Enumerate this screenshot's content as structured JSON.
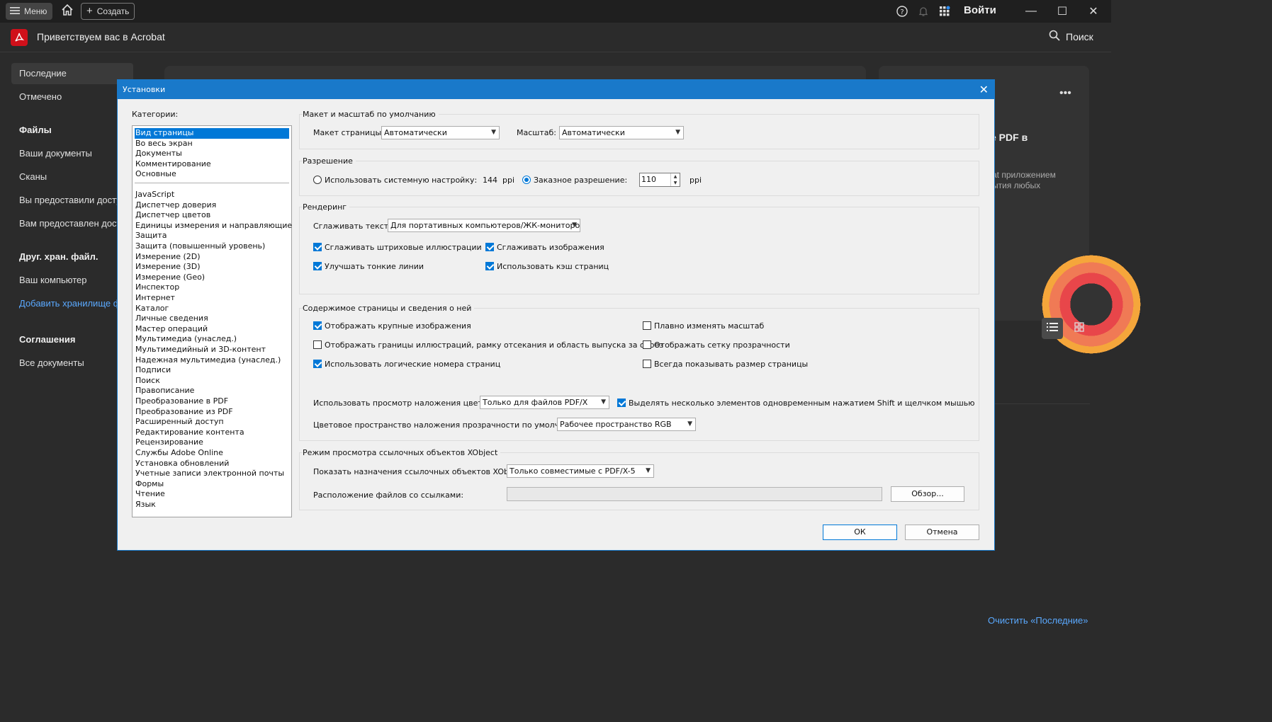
{
  "topbar": {
    "menu_label": "Меню",
    "create_label": "Создать",
    "signin_label": "Войти"
  },
  "app": {
    "title": "Приветствуем вас в Acrobat",
    "search_label": "Поиск"
  },
  "sidebar": {
    "recent": "Последние",
    "starred": "Отмечено",
    "files_heading": "Файлы",
    "your_docs": "Ваши документы",
    "scans": "Сканы",
    "shared_by_you": "Вы предоставили досту",
    "shared_with_you": "Вам предоставлен дост",
    "other_storage_heading": "Друг. хран. файл.",
    "your_computer": "Ваш компьютер",
    "add_storage": "Добавить хранилище ф",
    "agreements_heading": "Соглашения",
    "all_docs": "Все документы"
  },
  "background": {
    "pdf_title": "e PDF в",
    "pdf_desc": "at приложением\nытия любых",
    "clear_recent": "Очистить «Последние»"
  },
  "dialog": {
    "title": "Установки",
    "categories_label": "Категории:",
    "categories_top": [
      "Вид страницы",
      "Во весь экран",
      "Документы",
      "Комментирование",
      "Основные"
    ],
    "categories": [
      "JavaScript",
      "Диспетчер доверия",
      "Диспетчер цветов",
      "Единицы измерения и направляющие",
      "Защита",
      "Защита (повышенный уровень)",
      "Измерение (2D)",
      "Измерение (3D)",
      "Измерение (Geo)",
      "Инспектор",
      "Интернет",
      "Каталог",
      "Личные сведения",
      "Мастер операций",
      "Мультимедиа (унаслед.)",
      "Мультимедийный и 3D-контент",
      "Надежная мультимедиа (унаслед.)",
      "Подписи",
      "Поиск",
      "Правописание",
      "Преобразование в PDF",
      "Преобразование из PDF",
      "Расширенный доступ",
      "Редактирование контента",
      "Рецензирование",
      "Службы Adobe Online",
      "Установка обновлений",
      "Учетные записи электронной почты",
      "Формы",
      "Чтение",
      "Язык"
    ],
    "layout": {
      "group_label": "Макет и масштаб по умолчанию",
      "page_layout_label": "Макет страницы:",
      "page_layout_value": "Автоматически",
      "zoom_label": "Масштаб:",
      "zoom_value": "Автоматически"
    },
    "resolution": {
      "group_label": "Разрешение",
      "system_label": "Использовать системную настройку:",
      "system_value": "144",
      "system_unit": "ppi",
      "custom_label": "Заказное разрешение:",
      "custom_value": "110",
      "custom_unit": "ppi"
    },
    "rendering": {
      "group_label": "Рендеринг",
      "smooth_text_label": "Сглаживать текст:",
      "smooth_text_value": "Для портативных компьютеров/ЖК-мониторов",
      "smooth_line_art": "Сглаживать штриховые иллюстрации",
      "smooth_images": "Сглаживать изображения",
      "enhance_thin_lines": "Улучшать тонкие линии",
      "use_page_cache": "Использовать кэш страниц"
    },
    "content": {
      "group_label": "Содержимое страницы и сведения о ней",
      "show_large_images": "Отображать крупные изображения",
      "smooth_zoom": "Плавно изменять масштаб",
      "show_art_boxes": "Отображать границы иллюстраций, рамку отсекания и область выпуска за обрез",
      "show_transparency_grid": "Отображать сетку прозрачности",
      "logical_page_numbers": "Использовать логические номера страниц",
      "always_show_page_size": "Всегда показывать размер страницы",
      "overprint_label": "Использовать просмотр наложения цветов:",
      "overprint_value": "Только для файлов PDF/X",
      "shift_select": "Выделять несколько элементов одновременным нажатием Shift и щелчком мышью",
      "blend_space_label": "Цветовое пространство наложения прозрачности по умолчанию:",
      "blend_space_value": "Рабочее пространство RGB"
    },
    "xobject": {
      "group_label": "Режим просмотра ссылочных объектов XObject",
      "show_targets_label": "Показать назначения ссылочных объектов XObject:",
      "show_targets_value": "Только совместимые с PDF/X-5",
      "location_label": "Расположение файлов со ссылками:",
      "browse_label": "Обзор..."
    },
    "ok_label": "ОК",
    "cancel_label": "Отмена"
  }
}
